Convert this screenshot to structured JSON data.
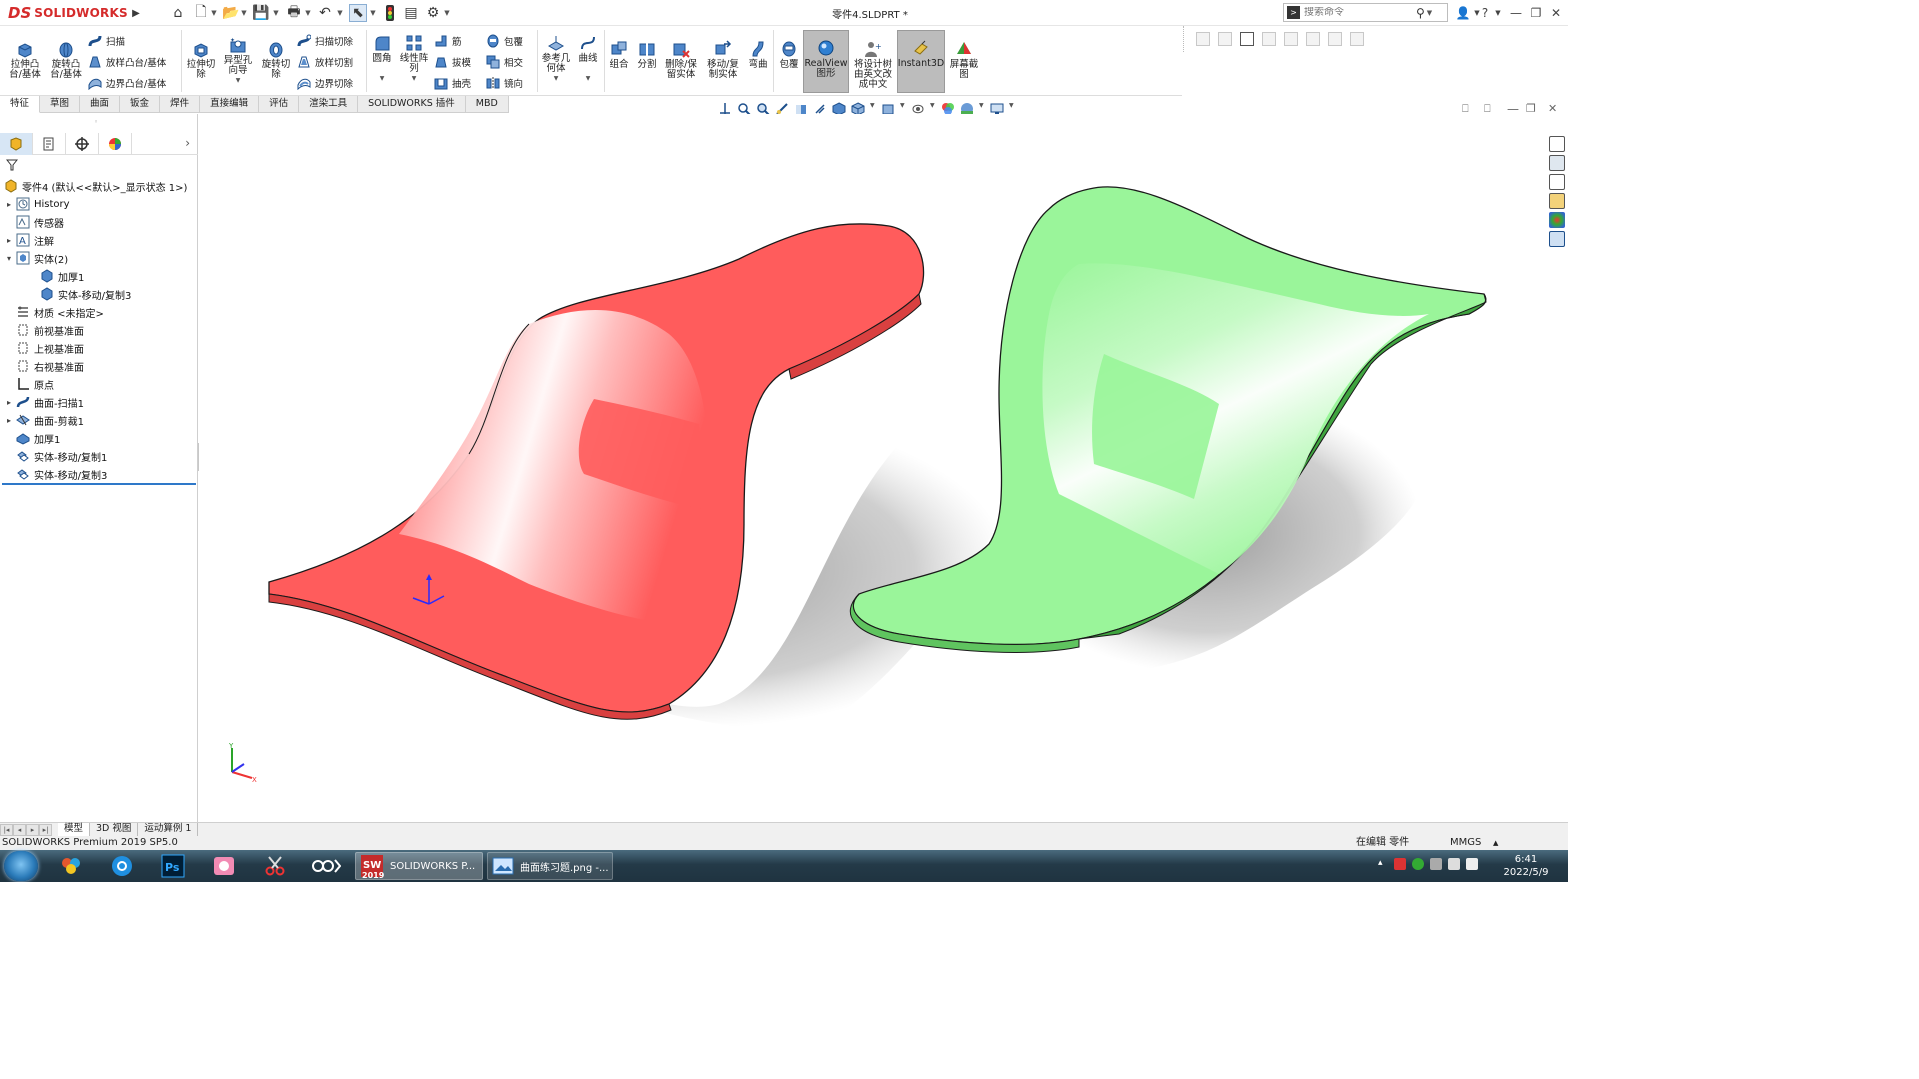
{
  "app": {
    "brand": "SOLIDWORKS",
    "document_title": "零件4.SLDPRT *",
    "search_placeholder": "搜索命令"
  },
  "ribbon": {
    "extrude_boss": "拉伸凸\n台/基体",
    "revolve_boss": "旋转凸\n台/基体",
    "swept_boss": "扫描",
    "lofted_boss": "放样凸台/基体",
    "boundary_boss": "边界凸台/基体",
    "extruded_cut": "拉伸切\n除",
    "hole_wizard": "异型孔\n向导",
    "revolved_cut": "旋转切\n除",
    "swept_cut": "扫描切除",
    "lofted_cut": "放样切割",
    "boundary_cut": "边界切除",
    "fillet": "圆角",
    "linear_pattern": "线性阵\n列",
    "rib": "筋",
    "draft": "拔模",
    "shell": "抽壳",
    "wrap": "包覆",
    "intersect": "相交",
    "mirror": "镜向",
    "ref_geometry": "参考几\n何体",
    "curves": "曲线",
    "combine": "组合",
    "split": "分割",
    "delete_keep_body": "删除/保\n留实体",
    "move_copy_body": "移动/复\n制实体",
    "flex": "弯曲",
    "wrap2": "包覆",
    "realview": "RealView\n图形",
    "translate_tree": "将设计树\n由英文改\n成中文",
    "instant3d": "Instant3D",
    "screen_capture": "屏幕截\n图"
  },
  "tabs": [
    "特征",
    "草图",
    "曲面",
    "钣金",
    "焊件",
    "直接编辑",
    "评估",
    "渲染工具",
    "SOLIDWORKS 插件",
    "MBD"
  ],
  "active_tab": "特征",
  "tree": {
    "root": "零件4  (默认<<默认>_显示状态 1>)",
    "items": {
      "history": "History",
      "sensors": "传感器",
      "annotations": "注解",
      "solid_bodies": "实体(2)",
      "body_thicken": "加厚1",
      "body_move": "实体-移动/复制3",
      "material": "材质 <未指定>",
      "front_plane": "前视基准面",
      "top_plane": "上视基准面",
      "right_plane": "右视基准面",
      "origin": "原点",
      "surface_sweep": "曲面-扫描1",
      "surface_trim": "曲面-剪裁1",
      "thicken": "加厚1",
      "move_copy1": "实体-移动/复制1",
      "move_copy3": "实体-移动/复制3"
    }
  },
  "bottom_tabs": [
    "模型",
    "3D 视图",
    "运动算例 1"
  ],
  "status": {
    "product": "SOLIDWORKS Premium 2019 SP5.0",
    "editing": "在编辑 零件",
    "units": "MMGS"
  },
  "taskbar": {
    "window1": "SOLIDWORKS P...",
    "window2": "曲面练习题.png -...",
    "time": "6:41",
    "date": "2022/5/9",
    "sw_badge": "2019"
  },
  "colors": {
    "red_body": "#ff5c5c",
    "green_body": "#9af59a",
    "accent": "#2e78c9",
    "brand_red": "#d52b2b"
  }
}
